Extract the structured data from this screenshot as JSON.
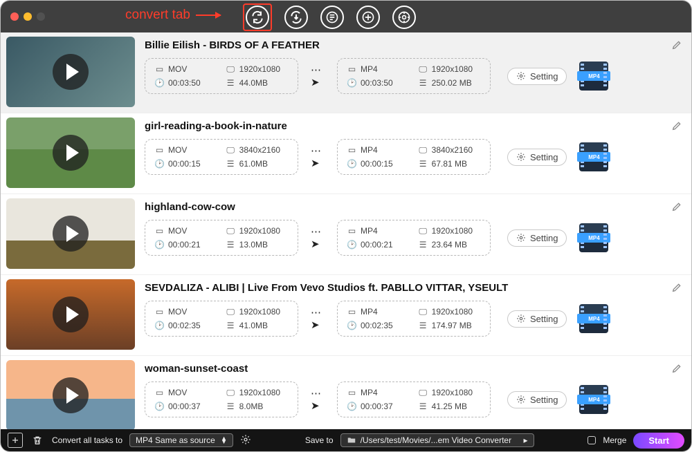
{
  "annotation": {
    "label": "convert tab"
  },
  "items": [
    {
      "title": "Billie Eilish - BIRDS OF A FEATHER",
      "selected": true,
      "src": {
        "fmt": "MOV",
        "res": "1920x1080",
        "dur": "00:03:50",
        "size": "44.0MB"
      },
      "dst": {
        "fmt": "MP4",
        "res": "1920x1080",
        "dur": "00:03:50",
        "size": "250.02 MB"
      }
    },
    {
      "title": "girl-reading-a-book-in-nature",
      "selected": false,
      "src": {
        "fmt": "MOV",
        "res": "3840x2160",
        "dur": "00:00:15",
        "size": "61.0MB"
      },
      "dst": {
        "fmt": "MP4",
        "res": "3840x2160",
        "dur": "00:00:15",
        "size": "67.81 MB"
      }
    },
    {
      "title": "highland-cow-cow",
      "selected": false,
      "src": {
        "fmt": "MOV",
        "res": "1920x1080",
        "dur": "00:00:21",
        "size": "13.0MB"
      },
      "dst": {
        "fmt": "MP4",
        "res": "1920x1080",
        "dur": "00:00:21",
        "size": "23.64 MB"
      }
    },
    {
      "title": "SEVDALIZA - ALIBI | Live From Vevo Studios ft. PABLLO VITTAR, YSEULT",
      "selected": false,
      "src": {
        "fmt": "MOV",
        "res": "1920x1080",
        "dur": "00:02:35",
        "size": "41.0MB"
      },
      "dst": {
        "fmt": "MP4",
        "res": "1920x1080",
        "dur": "00:02:35",
        "size": "174.97 MB"
      }
    },
    {
      "title": "woman-sunset-coast",
      "selected": false,
      "src": {
        "fmt": "MOV",
        "res": "1920x1080",
        "dur": "00:00:37",
        "size": "8.0MB"
      },
      "dst": {
        "fmt": "MP4",
        "res": "1920x1080",
        "dur": "00:00:37",
        "size": "41.25 MB"
      }
    }
  ],
  "setting_label": "Setting",
  "mp4chip_label": "MP4",
  "footer": {
    "convert_all_label": "Convert all tasks to",
    "convert_all_value": "MP4 Same as source",
    "save_to_label": "Save to",
    "save_to_path": "/Users/test/Movies/...em Video Converter",
    "merge_label": "Merge",
    "start_label": "Start"
  }
}
